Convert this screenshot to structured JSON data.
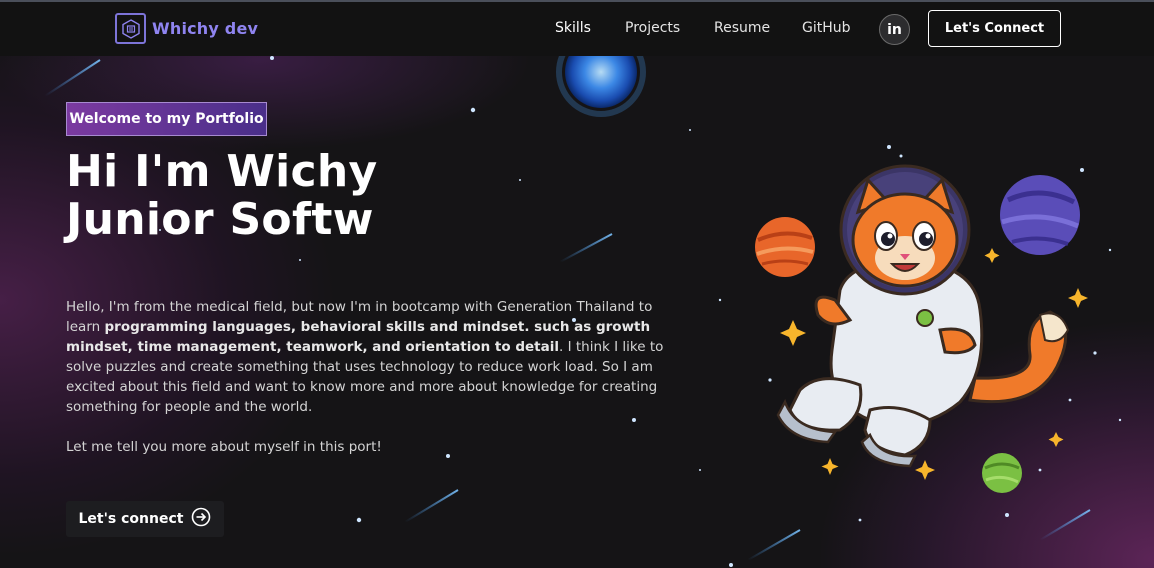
{
  "brand": {
    "name": "Whichy dev",
    "icon": "hexagon-logo-icon"
  },
  "nav": {
    "links": [
      {
        "label": "Skills"
      },
      {
        "label": "Projects"
      },
      {
        "label": "Resume"
      },
      {
        "label": "GitHub"
      }
    ],
    "linkedin_label": "in",
    "connect_label": "Let's Connect"
  },
  "hero": {
    "tagline": "Welcome to my Portfolio",
    "headline_line1": "Hi I'm Wichy",
    "headline_line2": "Junior Softw",
    "intro_part1": "Hello, I'm from the medical field, but now I'm in bootcamp with Generation Thailand to learn ",
    "intro_bold": "programming languages, behavioral skills and mindset. such as growth mindset, time management, teamwork, and orientation to detail",
    "intro_part2": ". I think I like to solve puzzles and create something that uses technology to reduce work load. So I am excited about this field and want to know more and more about knowledge for creating something for people and the world.",
    "outro": "Let me tell you more about myself in this port!",
    "cta_label": "Let's connect",
    "cta_icon": "arrow-circle-right-icon"
  },
  "illustration": {
    "subject": "astronaut-cat-illustration",
    "accent_orange": "#f07a2a",
    "accent_purple": "#5a4db8",
    "accent_green": "#7bc043"
  }
}
